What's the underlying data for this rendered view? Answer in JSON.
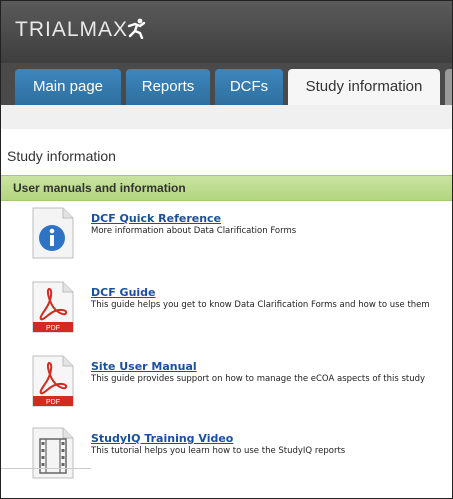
{
  "header": {
    "logo_text": "TRIALMAX"
  },
  "tabs": [
    {
      "label": "Main page",
      "active": false
    },
    {
      "label": "Reports",
      "active": false
    },
    {
      "label": "DCFs",
      "active": false
    },
    {
      "label": "Study information",
      "active": true
    }
  ],
  "page": {
    "title": "Study information"
  },
  "section": {
    "label": "User manuals and information"
  },
  "items": [
    {
      "title": "DCF Quick Reference",
      "desc": "More information about Data Clarification Forms",
      "icon": "info-document-icon"
    },
    {
      "title": "DCF Guide",
      "desc": "This guide helps you get to know Data Clarification Forms and how to use them",
      "icon": "pdf-icon"
    },
    {
      "title": "Site User Manual",
      "desc": "This guide provides support on how to manage the eCOA aspects of this study",
      "icon": "pdf-icon"
    },
    {
      "title": "StudyIQ Training Video",
      "desc": "This tutorial helps you learn how to use the StudyIQ reports",
      "icon": "video-film-icon"
    }
  ],
  "colors": {
    "tab_blue": "#2f6f9f",
    "section_green": "#b3d680",
    "link_blue": "#1a4fa0",
    "pdf_red": "#d12b22"
  }
}
